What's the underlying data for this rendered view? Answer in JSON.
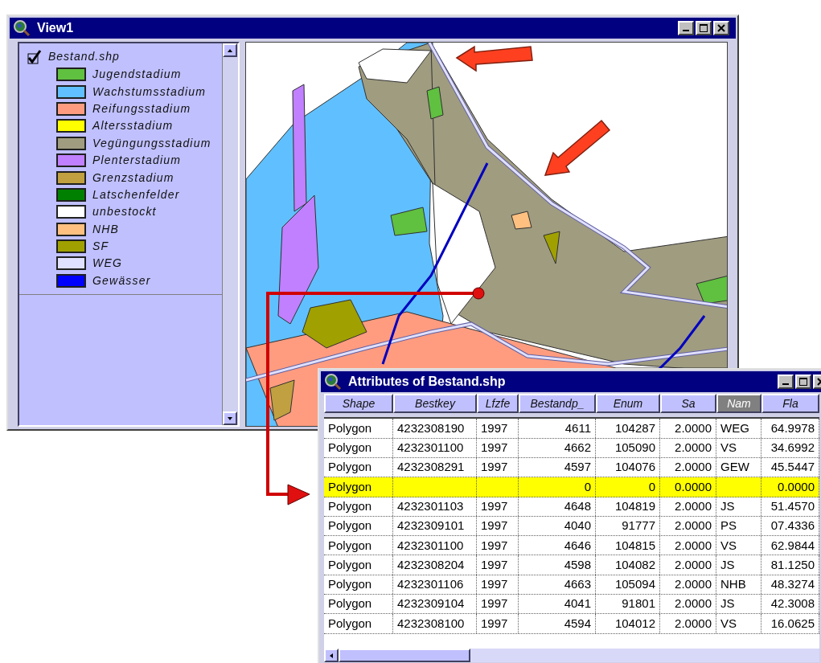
{
  "view_window": {
    "title": "View1",
    "legend": {
      "theme": {
        "name": "Bestand.shp",
        "checked": true
      },
      "classes": [
        {
          "label": "Jugendstadium",
          "color": "#60c040"
        },
        {
          "label": "Wachstumsstadium",
          "color": "#60c0ff"
        },
        {
          "label": "Reifungsstadium",
          "color": "#ff9c80"
        },
        {
          "label": "Altersstadium",
          "color": "#ffff00"
        },
        {
          "label": "Vegüngungsstadium",
          "color": "#a09c80"
        },
        {
          "label": "Plenterstadium",
          "color": "#c080ff"
        },
        {
          "label": "Grenzstadium",
          "color": "#c0a040"
        },
        {
          "label": "Latschenfelder",
          "color": "#008000"
        },
        {
          "label": "unbestockt",
          "color": "#ffffff"
        },
        {
          "label": "NHB",
          "color": "#ffc080"
        },
        {
          "label": "SF",
          "color": "#a0a000"
        },
        {
          "label": "WEG",
          "color": "#e0e0ff"
        },
        {
          "label": "Gewässer",
          "color": "#0000ff"
        }
      ]
    }
  },
  "attributes_window": {
    "title": "Attributes of Bestand.shp",
    "columns": [
      {
        "label": "Shape",
        "selected": false
      },
      {
        "label": "Bestkey",
        "selected": false
      },
      {
        "label": "Lfzfe",
        "selected": false
      },
      {
        "label": "Bestandp_",
        "selected": false
      },
      {
        "label": "Enum",
        "selected": false
      },
      {
        "label": "Sa",
        "selected": false
      },
      {
        "label": "Nam",
        "selected": true
      },
      {
        "label": "Fla",
        "selected": false
      }
    ],
    "rows": [
      {
        "selected": false,
        "cells": [
          {
            "text": "Polygon"
          },
          {
            "text": "4232308190"
          },
          {
            "text": "1997"
          },
          {
            "text": "4611"
          },
          {
            "text": "104287"
          },
          {
            "text": "2.0000"
          },
          {
            "text": "WEG"
          },
          {
            "text": "64.9978"
          }
        ]
      },
      {
        "selected": false,
        "cells": [
          {
            "text": "Polygon"
          },
          {
            "text": "4232301100"
          },
          {
            "text": "1997"
          },
          {
            "text": "4662"
          },
          {
            "text": "105090"
          },
          {
            "text": "2.0000"
          },
          {
            "text": "VS"
          },
          {
            "text": "34.6992"
          }
        ]
      },
      {
        "selected": false,
        "cells": [
          {
            "text": "Polygon"
          },
          {
            "text": "4232308291"
          },
          {
            "text": "1997"
          },
          {
            "text": "4597"
          },
          {
            "text": "104076"
          },
          {
            "text": "2.0000"
          },
          {
            "text": "GEW"
          },
          {
            "text": "45.5447"
          }
        ]
      },
      {
        "selected": true,
        "cells": [
          {
            "text": "Polygon"
          },
          {},
          {},
          {
            "text": "0"
          },
          {
            "text": "0"
          },
          {
            "text": "0.0000"
          },
          {},
          {
            "text": "0.0000"
          }
        ]
      },
      {
        "selected": false,
        "cells": [
          {
            "text": "Polygon"
          },
          {
            "text": "4232301103"
          },
          {
            "text": "1997"
          },
          {
            "text": "4648"
          },
          {
            "text": "104819"
          },
          {
            "text": "2.0000"
          },
          {
            "text": "JS"
          },
          {
            "text": "51.4570"
          }
        ]
      },
      {
        "selected": false,
        "cells": [
          {
            "text": "Polygon"
          },
          {
            "text": "4232309101"
          },
          {
            "text": "1997"
          },
          {
            "text": "4040"
          },
          {
            "text": "91777"
          },
          {
            "text": "2.0000"
          },
          {
            "text": "PS"
          },
          {
            "text": "07.4336"
          }
        ]
      },
      {
        "selected": false,
        "cells": [
          {
            "text": "Polygon"
          },
          {
            "text": "4232301100"
          },
          {
            "text": "1997"
          },
          {
            "text": "4646"
          },
          {
            "text": "104815"
          },
          {
            "text": "2.0000"
          },
          {
            "text": "VS"
          },
          {
            "text": "62.9844"
          }
        ]
      },
      {
        "selected": false,
        "cells": [
          {
            "text": "Polygon"
          },
          {
            "text": "4232308204"
          },
          {
            "text": "1997"
          },
          {
            "text": "4598"
          },
          {
            "text": "104082"
          },
          {
            "text": "2.0000"
          },
          {
            "text": "JS"
          },
          {
            "text": "81.1250"
          }
        ]
      },
      {
        "selected": false,
        "cells": [
          {
            "text": "Polygon"
          },
          {
            "text": "4232301106"
          },
          {
            "text": "1997"
          },
          {
            "text": "4663"
          },
          {
            "text": "105094"
          },
          {
            "text": "2.0000"
          },
          {
            "text": "NHB"
          },
          {
            "text": "48.3274"
          }
        ]
      },
      {
        "selected": false,
        "cells": [
          {
            "text": "Polygon"
          },
          {
            "text": "4232309104"
          },
          {
            "text": "1997"
          },
          {
            "text": "4041"
          },
          {
            "text": "91801"
          },
          {
            "text": "2.0000"
          },
          {
            "text": "JS"
          },
          {
            "text": "42.3008"
          }
        ]
      },
      {
        "selected": false,
        "cells": [
          {
            "text": "Polygon"
          },
          {
            "text": "4232308100"
          },
          {
            "text": "1997"
          },
          {
            "text": "4594"
          },
          {
            "text": "104012"
          },
          {
            "text": "2.0000"
          },
          {
            "text": "VS"
          },
          {
            "text": "16.0625"
          }
        ]
      }
    ]
  }
}
